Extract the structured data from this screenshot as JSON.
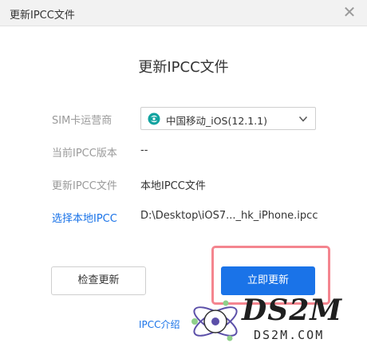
{
  "window": {
    "title": "更新IPCC文件",
    "close_icon": "close-icon"
  },
  "dialog": {
    "heading": "更新IPCC文件",
    "sim_carrier_label": "SIM卡运营商",
    "carrier_select": {
      "selected": "中国移动_iOS(12.1.1)",
      "icon": "china-mobile-logo-icon"
    },
    "current_version_label": "当前IPCC版本",
    "current_version_value": "--",
    "ipcc_file_label": "更新IPCC文件",
    "ipcc_file_value": "本地IPCC文件",
    "choose_local_link": "选择本地IPCC",
    "file_path": "D:\\Desktop\\iOS7..._hk_iPhone.ipcc",
    "check_update_button": "检查更新",
    "update_now_button": "立即更新",
    "ipcc_intro_link": "IPCC介绍"
  },
  "watermark": {
    "brand": "DS2M",
    "url": "DS2M.COM"
  },
  "colors": {
    "accent": "#1a73e8",
    "highlight": "#f4858f",
    "titlebar": "#f2f2f2"
  }
}
